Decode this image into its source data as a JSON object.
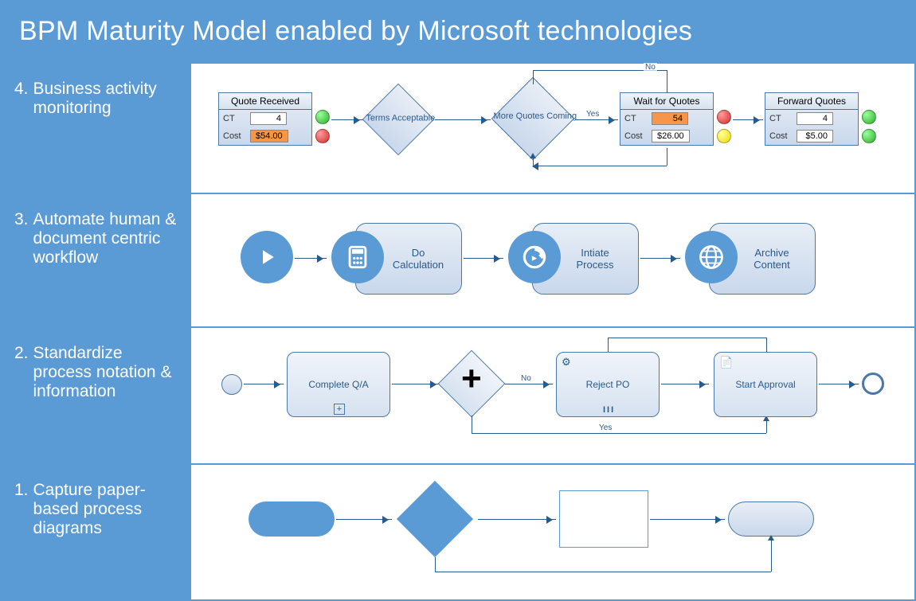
{
  "title": "BPM Maturity Model enabled by Microsoft technologies",
  "rows": {
    "r4": {
      "num": "4.",
      "label": "Business activity monitoring"
    },
    "r3": {
      "num": "3.",
      "label": "Automate human & document centric workflow"
    },
    "r2": {
      "num": "2.",
      "label": "Standardize process notation & information"
    },
    "r1": {
      "num": "1.",
      "label": "Capture paper-based process diagrams"
    }
  },
  "bam": {
    "box1": {
      "title": "Quote Received",
      "ct_lbl": "CT",
      "ct_val": "4",
      "ct_status": "green",
      "cost_lbl": "Cost",
      "cost_val": "$54.00",
      "cost_status": "red",
      "cost_hot": true
    },
    "dec1": "Terms Acceptable",
    "dec2": "More Quotes Coming",
    "yes": "Yes",
    "no": "No",
    "box2": {
      "title": "Wait for Quotes",
      "ct_lbl": "CT",
      "ct_val": "54",
      "ct_status": "red",
      "ct_hot": true,
      "cost_lbl": "Cost",
      "cost_val": "$26.00",
      "cost_status": "yellow"
    },
    "box3": {
      "title": "Forward Quotes",
      "ct_lbl": "CT",
      "ct_val": "4",
      "ct_status": "green",
      "cost_lbl": "Cost",
      "cost_val": "$5.00",
      "cost_status": "green"
    }
  },
  "wf": {
    "step1": "Do Calculation",
    "step2": "Intiate Process",
    "step3": "Archive Content"
  },
  "bpmn": {
    "task1": "Complete Q/A",
    "task2": "Reject PO",
    "task3": "Start Approval",
    "no": "No",
    "yes": "Yes"
  }
}
